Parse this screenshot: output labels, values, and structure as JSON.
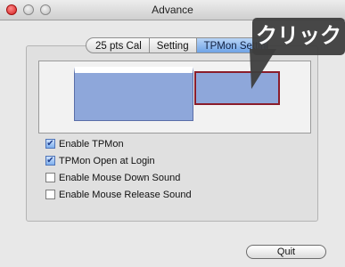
{
  "window": {
    "title": "Advance"
  },
  "tabs": [
    {
      "label": "25 pts Cal",
      "active": false
    },
    {
      "label": "Setting",
      "active": false
    },
    {
      "label": "TPMon Setting",
      "active": true
    }
  ],
  "options": [
    {
      "label": "Enable TPMon",
      "checked": true
    },
    {
      "label": "TPMon Open at Login",
      "checked": true
    },
    {
      "label": "Enable Mouse Down Sound",
      "checked": false
    },
    {
      "label": "Enable Mouse Release Sound",
      "checked": false
    }
  ],
  "buttons": {
    "quit": "Quit"
  },
  "annotation": {
    "callout_text": "クリック"
  },
  "colors": {
    "screen_fill": "#8ea7da",
    "selected_border": "#8a1d2b",
    "callout_bg": "#3e3e3e"
  }
}
